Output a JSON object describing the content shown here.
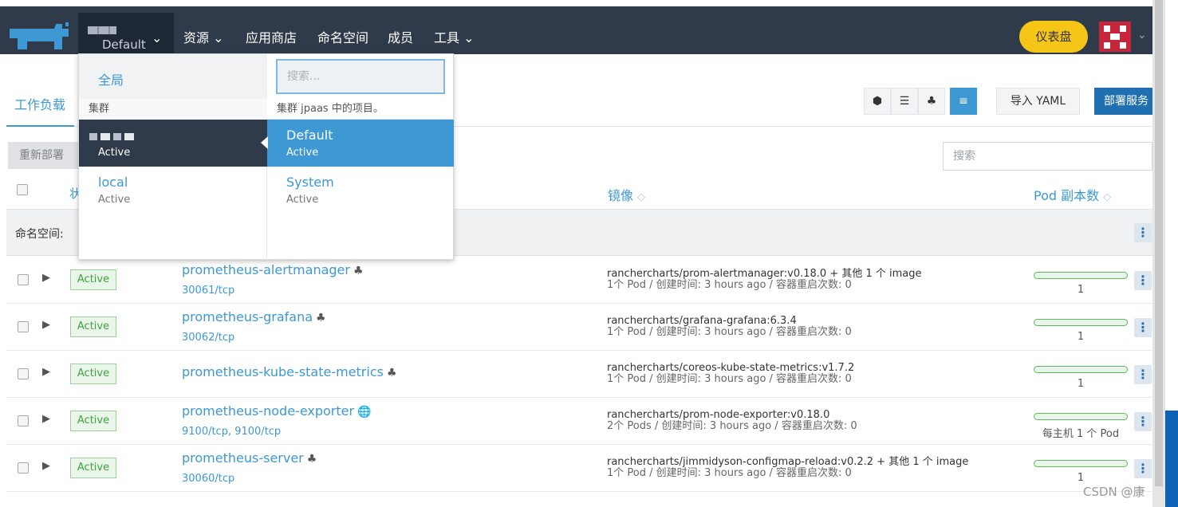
{
  "topbar": {
    "cluster_project": "Default",
    "nav": [
      "资源",
      "应用商店",
      "命名空间",
      "成员",
      "工具"
    ],
    "dashboard_label": "仪表盘"
  },
  "header": {
    "tab_workload": "工作负载",
    "import_yaml": "导入 YAML",
    "deploy_service": "部署服务",
    "redeploy": "重新部署",
    "search_placeholder": "搜索"
  },
  "table": {
    "col_state": "状",
    "col_image": "镜像",
    "col_pods": "Pod 副本数",
    "namespace_label": "命名空间:"
  },
  "rows": [
    {
      "state": "Active",
      "name": "prometheus-alertmanager",
      "ports": "30061/tcp",
      "icon": "workload-icon",
      "image": "ranchercharts/prom-alertmanager:v0.18.0 + 其他 1 个 image",
      "meta": "1个 Pod / 创建时间: 3 hours ago / 容器重启次数: 0",
      "pods": "1"
    },
    {
      "state": "Active",
      "name": "prometheus-grafana",
      "ports": "30062/tcp",
      "icon": "workload-icon",
      "image": "ranchercharts/grafana-grafana:6.3.4",
      "meta": "1个 Pod / 创建时间: 3 hours ago / 容器重启次数: 0",
      "pods": "1"
    },
    {
      "state": "Active",
      "name": "prometheus-kube-state-metrics",
      "ports": "",
      "icon": "workload-icon",
      "image": "ranchercharts/coreos-kube-state-metrics:v1.7.2",
      "meta": "1个 Pod / 创建时间: 3 hours ago / 容器重启次数: 0",
      "pods": "1"
    },
    {
      "state": "Active",
      "name": "prometheus-node-exporter",
      "ports": "9100/tcp, 9100/tcp",
      "icon": "globe-icon",
      "image": "ranchercharts/prom-node-exporter:v0.18.0",
      "meta": "2个 Pods / 创建时间: 3 hours ago / 容器重启次数: 0",
      "pods": "每主机 1 个 Pod"
    },
    {
      "state": "Active",
      "name": "prometheus-server",
      "ports": "30060/tcp",
      "icon": "workload-icon",
      "image": "ranchercharts/jimmidyson-configmap-reload:v0.2.2 + 其他 1 个 image",
      "meta": "1个 Pod / 创建时间: 3 hours ago / 容器重启次数: 0",
      "pods": "1"
    }
  ],
  "dropdown": {
    "global": "全局",
    "clusters_header": "集群",
    "search_placeholder": "搜索...",
    "projects_header": "集群 jpaas 中的项目。",
    "clusters": [
      {
        "name": "",
        "status": "Active"
      },
      {
        "name": "local",
        "status": "Active"
      }
    ],
    "projects": [
      {
        "name": "Default",
        "status": "Active"
      },
      {
        "name": "System",
        "status": "Active"
      }
    ]
  },
  "watermark": "CSDN @康",
  "colors": {
    "nav_bg": "#2f3b4a",
    "accent": "#3d98d3",
    "active_green": "#3fa13f",
    "dashboard_yellow": "#f5c518"
  }
}
